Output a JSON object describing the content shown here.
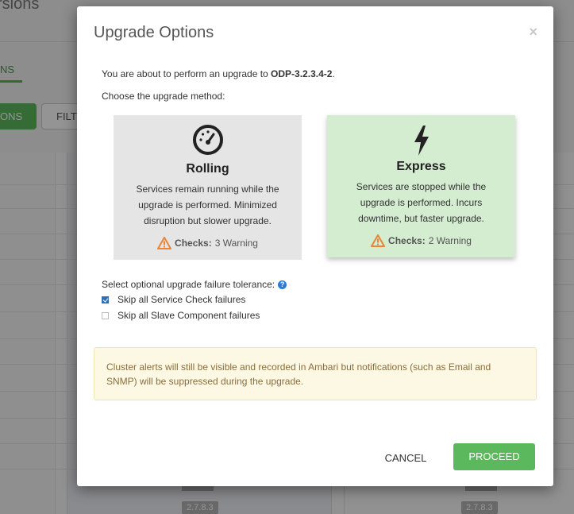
{
  "background": {
    "title": "rsions",
    "tab": "NS",
    "green_button": "ONS",
    "filter_button": "FILT",
    "version_tags": [
      "2.7.8.3",
      "2.7.8.3"
    ]
  },
  "modal": {
    "title": "Upgrade Options",
    "close": "×",
    "intro_prefix": "You are about to perform an upgrade to ",
    "intro_version": "ODP-3.2.3.4-2",
    "intro_suffix": ".",
    "choose_method": "Choose the upgrade method:",
    "methods": [
      {
        "name": "Rolling",
        "icon": "speedometer-icon",
        "description": "Services remain running while the upgrade is performed. Minimized disruption but slower upgrade.",
        "checks_label": "Checks:",
        "checks_value": "3 Warning",
        "selected": false
      },
      {
        "name": "Express",
        "icon": "lightning-bolt-icon",
        "description": "Services are stopped while the upgrade is performed. Incurs downtime, but faster upgrade.",
        "checks_label": "Checks:",
        "checks_value": "2 Warning",
        "selected": true
      }
    ],
    "tolerance_label": "Select optional upgrade failure tolerance:",
    "tolerance_options": [
      {
        "label": "Skip all Service Check failures",
        "checked": true
      },
      {
        "label": "Skip all Slave Component failures",
        "checked": false
      }
    ],
    "alert_text": "Cluster alerts will still be visible and recorded in Ambari but notifications (such as Email and SNMP) will be suppressed during the upgrade.",
    "cancel_label": "CANCEL",
    "proceed_label": "PROCEED"
  },
  "colors": {
    "accent_green": "#5cb85c",
    "warning_orange": "#e8853a",
    "selected_card": "#d4ecd0",
    "alert_bg": "#fcf8e3",
    "alert_text": "#8a6d3b"
  }
}
